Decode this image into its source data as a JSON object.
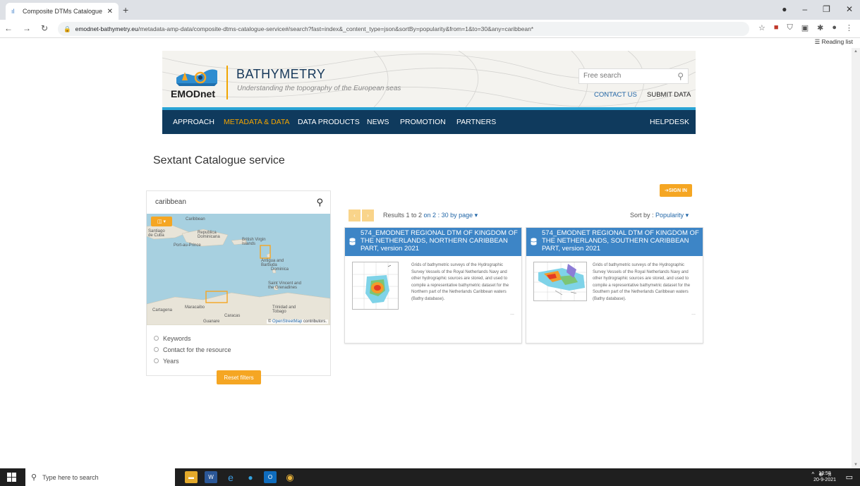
{
  "browser": {
    "tab_title": "Composite DTMs Catalogue serv",
    "url_host": "emodnet-bathymetry.eu",
    "url_path": "/metadata-amp-data/composite-dtms-catalogue-service#/search?fast=index&_content_type=json&sortBy=popularity&from=1&to=30&any=caribbean*",
    "reading_list": "Reading list"
  },
  "site": {
    "logo_text": "EMODnet",
    "title": "BATHYMETRY",
    "tagline": "Understanding the topography of the European seas",
    "search_placeholder": "Free search",
    "contact": "CONTACT US",
    "submit": "SUBMIT DATA",
    "nav": [
      {
        "label": "APPROACH"
      },
      {
        "label": "METADATA & DATA"
      },
      {
        "label": "DATA PRODUCTS"
      },
      {
        "label": "NEWS"
      },
      {
        "label": "PROMOTION"
      },
      {
        "label": "PARTNERS"
      },
      {
        "label": "HELPDESK"
      }
    ]
  },
  "catalogue": {
    "heading": "Sextant Catalogue service",
    "sign_in": "SIGN IN",
    "search_value": "caribbean",
    "map_credit_prefix": "©",
    "map_credit_link": "OpenStreetMap",
    "map_credit_suffix": "contributors.",
    "map_labels": [
      "Santiago de Cuba",
      "Republica Dominicana",
      "Port-au-Prince",
      "British Virgin Islands",
      "Antigua and Barbuda",
      "Dominica",
      "Saint Vincent and the Grenadines",
      "Trinidad and Tobago",
      "Caracas",
      "Maracaibo",
      "Cartagena",
      "Guanare",
      "Caribbean"
    ],
    "facets": [
      "Keywords",
      "Contact for the resource",
      "Years"
    ],
    "reset": "Reset filters",
    "results_prefix": "Results 1 to 2",
    "results_total": "on 2 : 30 by page",
    "sort_label": "Sort by :",
    "sort_value": "Popularity",
    "cards": [
      {
        "title": "574_EMODNET REGIONAL DTM OF KINGDOM OF THE NETHERLANDS, NORTHERN CARIBBEAN PART, version 2021",
        "desc": "Grids of bathymetric surveys of the Hydrographic Survey Vessels of the Royal Netherlands Navy and other hydrographic sources are stored, and used to compile a representative bathymetric dataset for the Northern part of the Netherlands Caribbean waters (Bathy database).",
        "more": "..."
      },
      {
        "title": "574_EMODNET REGIONAL DTM OF KINGDOM OF THE NETHERLANDS, SOUTHERN CARIBBEAN PART, version 2021",
        "desc": "Grids of bathymetric surveys of the Hydrographic Survey Vessels of the Royal Netherlands Navy and other hydrographic sources are stored, and used to compile a representative bathymetric dataset for the Southern part of the Netherlands Caribbean waters (Bathy database).",
        "more": "..."
      }
    ]
  },
  "taskbar": {
    "search_placeholder": "Type here to search",
    "time": "13:58",
    "date": "20-9-2021"
  }
}
